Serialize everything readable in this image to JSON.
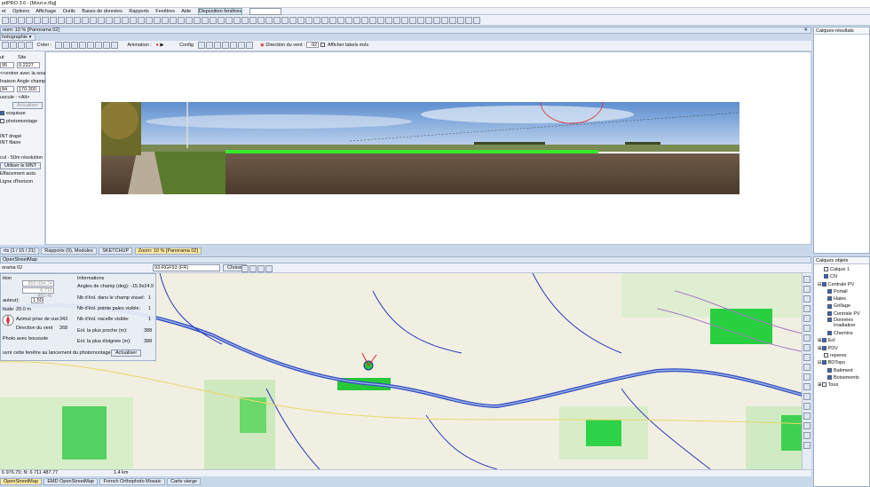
{
  "title": "pdPRO 3.6 - [Mout-e.t6g]",
  "menu": [
    "et",
    "Options",
    "Affichage",
    "Outils",
    "Bases de données",
    "Rapports",
    "Fenêtres",
    "Aide",
    "Disposition fenêtres"
  ],
  "panorama_window": {
    "title": "oom: 10 % [Panorama 02]",
    "left_tab": "hotographie",
    "toolbar": {
      "create": "Créer :",
      "animation": "Animation :",
      "config": "Config",
      "wind": "Direction du vent :",
      "wind_value": "-92",
      "labels": "Afficher labels éols"
    },
    "left": {
      "l1": "ut",
      "l2": "Site",
      "v1": "95",
      "v2": "0.2227",
      "l3": "<<entrer avec la souris",
      "l4": "Inaison",
      "l5": "Angle champ",
      "v4": "84",
      "v5": "170.300",
      "l6": "uscule : <Alt>",
      "actualise": "Actualiser",
      "esquisse": "esquisse",
      "photomontage": "photomontage",
      "mnt1": "INT drapé",
      "mnt2": "INT filaire",
      "res": "cul - 50m résolution",
      "use_mnt": "Utiliser le MNT",
      "eff": "Effacement auto.",
      "horizon": "Ligne d'horizon"
    }
  },
  "middle_tabs": [
    "rts (1 / 15 / 21)",
    "Rapports (0), Modules",
    "SKETCHUP",
    "Zoom: 10 % [Panorama 02]"
  ],
  "map_window": {
    "title": "OpenStreetMap",
    "sub": "orama 02",
    "proj": "93-RGF93 (FR)",
    "choisir": "Choisir",
    "panel": {
      "position": "ition",
      "c1": "850 094.74",
      "c2": "6 710 493.46",
      "hauteur": "auteur):",
      "h_val": "1.50",
      "alt": "itude: 20.0 m",
      "azimut_l": "Azimut prise de vue",
      "azimut_v": "343",
      "vent_l": "Direction du vent",
      "vent_v": "268",
      "boussole": "Photo avec boussole",
      "ouvrir": "uvrir cette fenêtre au lancement du photomontage",
      "actualiser": "Actualiser",
      "info_title": "Informations",
      "angles_l": "Angles de champ (deg):",
      "angles_v": "-15.9x24.9",
      "n1_l": "Nb d'éol. dans le champ visuel:",
      "n1_v": "1",
      "n2_l": "Nb d'éol. pointe pales visible:",
      "n2_v": "1",
      "n3_l": "Nb d'éol. nacelle visible:",
      "n3_v": "1",
      "e1_l": "Eol. la plus proche (m):",
      "e1_v": "388",
      "e2_l": "Eol. la plus éloignée (m):",
      "e2_v": "388"
    },
    "coords": "6 976.70; N: 6 711 487.77",
    "scale": "1.4 km"
  },
  "bottom_tabs": [
    "OpenStreetMap",
    "EMD OpenStreetMap",
    "French Orthophoto Mosaic",
    "Carte vierge"
  ],
  "results": {
    "title": "Calques-résultats"
  },
  "objects": {
    "title": "Calques objets",
    "items": [
      "Calque 1",
      "CN",
      "Centrale PV",
      "Portail",
      "Haies",
      "Grillage",
      "Centrale PV",
      "Données Irradiation",
      "Chemins",
      "Eol",
      "PDV",
      "reperes",
      "BDTopo",
      "Batiment",
      "Boisements",
      "Tous"
    ]
  },
  "colors": {
    "accent": "#2e6ac0",
    "title_bg": "#dce6f4"
  }
}
